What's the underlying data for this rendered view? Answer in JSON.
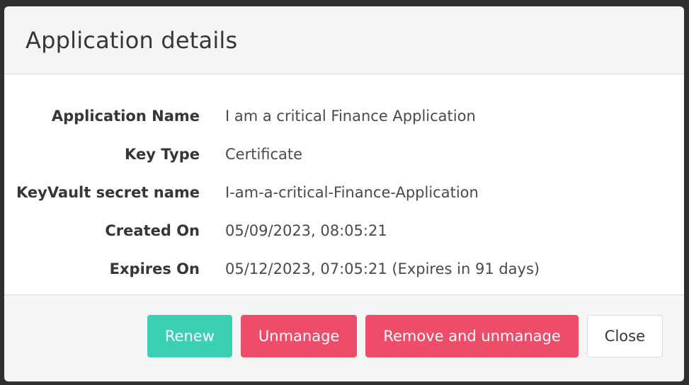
{
  "dialog": {
    "title": "Application details"
  },
  "details": [
    {
      "label": "Application Name",
      "value": "I am a critical Finance Application"
    },
    {
      "label": "Key Type",
      "value": "Certificate"
    },
    {
      "label": "KeyVault secret name",
      "value": "I-am-a-critical-Finance-Application"
    },
    {
      "label": "Created On",
      "value": "05/09/2023, 08:05:21"
    },
    {
      "label": "Expires On",
      "value": "05/12/2023, 07:05:21 (Expires in 91 days)"
    }
  ],
  "footer": {
    "renew_label": "Renew",
    "unmanage_label": "Unmanage",
    "remove_unmanage_label": "Remove and unmanage",
    "close_label": "Close"
  },
  "colors": {
    "renew": "#3bd0b4",
    "danger": "#ee4d6a",
    "header_bg": "#f5f5f5"
  }
}
